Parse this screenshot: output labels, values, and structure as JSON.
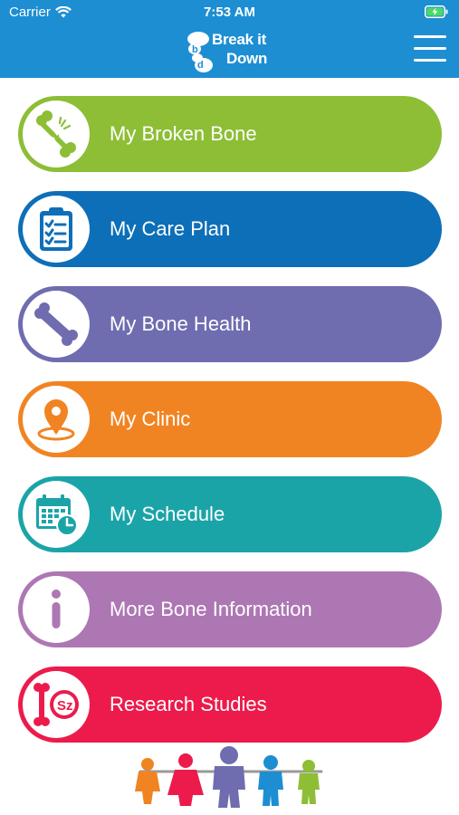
{
  "status_bar": {
    "carrier": "Carrier",
    "time": "7:53 AM"
  },
  "header": {
    "logo_line1": "Break it",
    "logo_line2": "Down",
    "menu_icon": "hamburger-icon"
  },
  "menu": [
    {
      "label": "My Broken Bone",
      "color": "#8dbe36",
      "icon": "broken-bone-icon"
    },
    {
      "label": "My Care Plan",
      "color": "#0d6fb8",
      "icon": "clipboard-icon"
    },
    {
      "label": "My Bone Health",
      "color": "#6f6cb0",
      "icon": "bone-icon"
    },
    {
      "label": "My Clinic",
      "color": "#f18422",
      "icon": "location-pin-icon"
    },
    {
      "label": "My Schedule",
      "color": "#1ba4a8",
      "icon": "calendar-clock-icon"
    },
    {
      "label": "More Bone Information",
      "color": "#ad77b3",
      "icon": "info-icon"
    },
    {
      "label": "Research Studies",
      "color": "#ec1b4b",
      "icon": "research-icon"
    }
  ],
  "colors": {
    "header_bg": "#1d8ed2"
  }
}
